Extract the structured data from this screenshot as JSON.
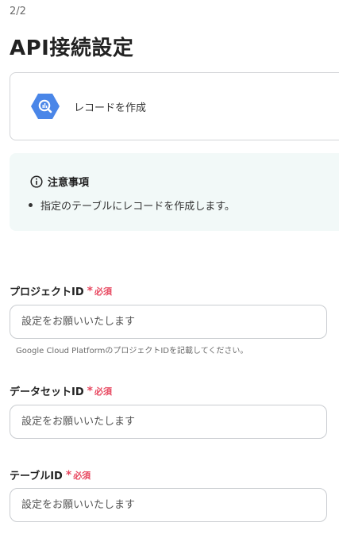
{
  "header": {
    "step": "2/2",
    "title": "API接続設定"
  },
  "action": {
    "icon": "bigquery-icon",
    "label": "レコードを作成"
  },
  "notice": {
    "icon": "info-icon",
    "title": "注意事項",
    "items": [
      "指定のテーブルにレコードを作成します。"
    ]
  },
  "fields": [
    {
      "label": "プロジェクトID",
      "required_mark": "*",
      "required_text": "必須",
      "placeholder": "設定をお願いいたします",
      "help": "Google Cloud PlatformのプロジェクトIDを記載してください。"
    },
    {
      "label": "データセットID",
      "required_mark": "*",
      "required_text": "必須",
      "placeholder": "設定をお願いいたします"
    },
    {
      "label": "テーブルID",
      "required_mark": "*",
      "required_text": "必須",
      "placeholder": "設定をお願いいたします"
    }
  ],
  "colors": {
    "accent_required": "#e8475f",
    "notice_bg": "#f2f9f8",
    "bigquery_blue": "#4a86e8"
  }
}
